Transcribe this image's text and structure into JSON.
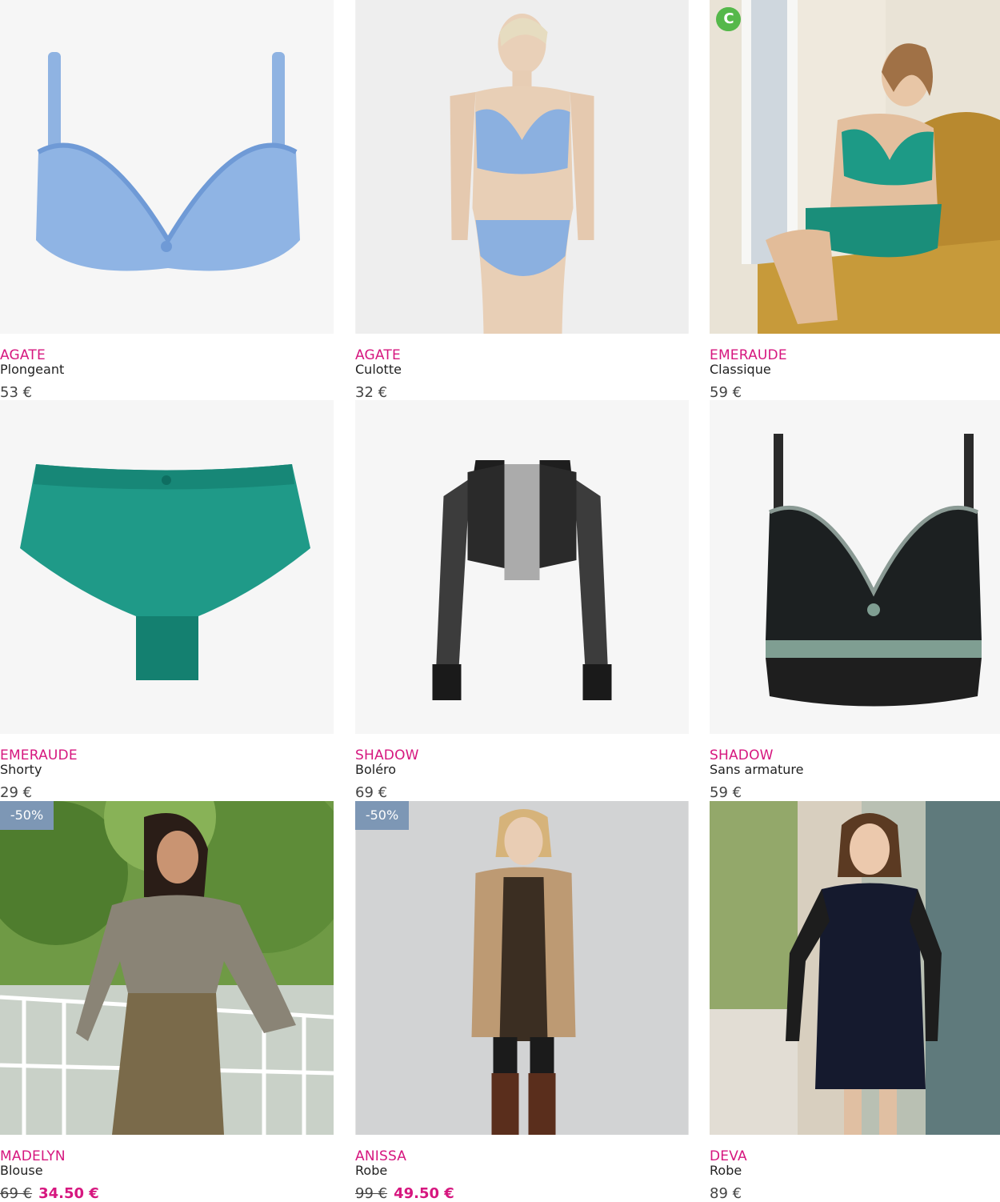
{
  "colors": {
    "brand_accent": "#d6177f",
    "sale_badge": "#7d97b5",
    "price_text": "#444444"
  },
  "products": [
    {
      "brand": "AGATE",
      "model": "Plongeant",
      "price": "53 €"
    },
    {
      "brand": "AGATE",
      "model": "Culotte",
      "price": "32 €"
    },
    {
      "brand": "EMERAUDE",
      "model": "Classique",
      "price": "59 €",
      "logo_text": "C"
    },
    {
      "brand": "EMERAUDE",
      "model": "Shorty",
      "price": "29 €"
    },
    {
      "brand": "SHADOW",
      "model": "Boléro",
      "price": "69 €"
    },
    {
      "brand": "SHADOW",
      "model": "Sans armature",
      "price": "59 €"
    },
    {
      "brand": "MADELYN",
      "model": "Blouse",
      "old_price": "69 €",
      "price": "34.50 €",
      "badge": "-50%"
    },
    {
      "brand": "ANISSA",
      "model": "Robe",
      "old_price": "99 €",
      "price": "49.50 €",
      "badge": "-50%"
    },
    {
      "brand": "DEVA",
      "model": "Robe",
      "price": "89 €"
    }
  ]
}
